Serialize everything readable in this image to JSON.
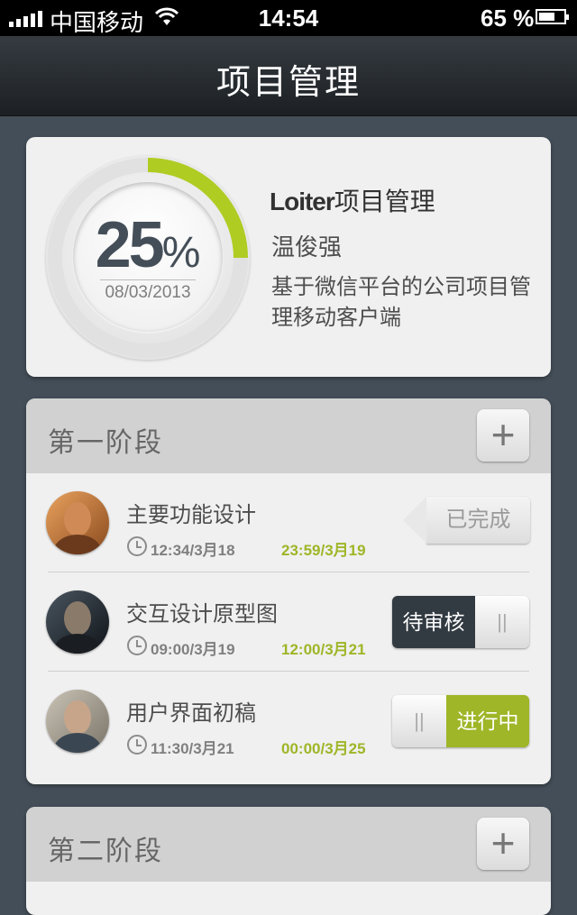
{
  "status_bar": {
    "carrier": "中国移动",
    "time": "14:54",
    "battery_pct": "65 %",
    "battery_level": 0.65
  },
  "navbar": {
    "title": "项目管理"
  },
  "project": {
    "progress_value": 0.25,
    "progress_number": "25",
    "progress_sign": "%",
    "date": "08/03/2013",
    "name_brand": "Loiter",
    "name_rest": "项目管理",
    "owner": "温俊强",
    "description": "基于微信平台的公司项目管理移动客户端",
    "ring_color": "#AFCC22"
  },
  "stages": [
    {
      "title": "第一阶段",
      "add_icon": "+",
      "tasks": [
        {
          "name": "主要功能设计",
          "start_time": "12:34/3月18",
          "end_time": "23:59/3月19",
          "status_label": "已完成",
          "status": "done"
        },
        {
          "name": "交互设计原型图",
          "start_time": "09:00/3月19",
          "end_time": "12:00/3月21",
          "status_label": "待审核",
          "status": "review"
        },
        {
          "name": "用户界面初稿",
          "start_time": "11:30/3月21",
          "end_time": "00:00/3月25",
          "status_label": "进行中",
          "status": "in_progress"
        }
      ]
    },
    {
      "title": "第二阶段",
      "add_icon": "+"
    }
  ],
  "colors": {
    "background": "#444E58",
    "accent_green": "#AFCC22",
    "end_time_green": "#9EB627",
    "card_bg": "#F0F0F0",
    "stage_header_bg": "#D1D1D1",
    "title_text": "#323232",
    "body_text": "#4D4D4D",
    "stage_title_text": "#666666",
    "date_text": "#7E7E7E",
    "time_text": "#808080"
  }
}
